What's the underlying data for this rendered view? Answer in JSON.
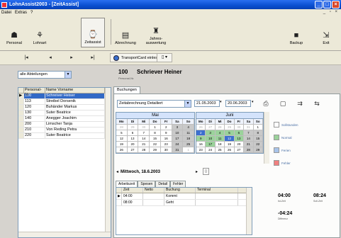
{
  "window": {
    "title": "LohnAssist2003 - [ZeitAssist]"
  },
  "menu": [
    "Datei",
    "Extras",
    "?"
  ],
  "toolbar": {
    "personal": "Personal",
    "lohnart": "Lohnart",
    "zeitassist": "Zeitassist",
    "abrechnung": "Abrechnung",
    "jahres": "Jahres-",
    "auswertung": "auswertung",
    "backup": "Backup",
    "exit": "Exit"
  },
  "nav": {
    "first": "|◂",
    "prev": "◂",
    "next": "▸",
    "last": "▸|",
    "transportcard": "TransportCard einlesen",
    "dropdown_icon": "page-icon"
  },
  "filter": {
    "selected": "alle Abteilungen"
  },
  "employees": {
    "headers": [
      "Personal-Nr",
      "Name Vorname"
    ],
    "rows": [
      {
        "nr": "100",
        "name": "Schreiver Heiser"
      },
      {
        "nr": "113",
        "name": "Streibel Dorsenik"
      },
      {
        "nr": "120",
        "name": "Buhänder Markus"
      },
      {
        "nr": "130",
        "name": "Suter Beatrice"
      },
      {
        "nr": "140",
        "name": "Anegger Joachim"
      },
      {
        "nr": "200",
        "name": "Limscher Tanja"
      },
      {
        "nr": "210",
        "name": "Von Reding Petra"
      },
      {
        "nr": "220",
        "name": "Suter Beatrice"
      }
    ]
  },
  "person": {
    "nr": "100",
    "nr_label": "Personal-Nr.",
    "name": "Schriever Heiner"
  },
  "tabs": {
    "buchungen": "Buchungen"
  },
  "report": {
    "selected": "Zeitabrechnung Detailiert",
    "from": "21.05.2003",
    "to": "20.06.2003"
  },
  "calendar": {
    "weekdays": [
      "Mo",
      "Di",
      "Mi",
      "Do",
      "Fr",
      "Sa",
      "So"
    ],
    "months": [
      {
        "name": "Mai",
        "days": [
          "28",
          "29",
          "30",
          "1",
          "2",
          "3",
          "4",
          "5",
          "6",
          "7",
          "8",
          "9",
          "10",
          "11",
          "12",
          "13",
          "14",
          "15",
          "16",
          "17",
          "18",
          "19",
          "20",
          "21",
          "22",
          "23",
          "24",
          "25",
          "26",
          "27",
          "28",
          "29",
          "30",
          "31",
          "1"
        ]
      },
      {
        "name": "Juni",
        "days": [
          "26",
          "27",
          "28",
          "29",
          "30",
          "31",
          "1",
          "2",
          "3",
          "4",
          "5",
          "6",
          "7",
          "8",
          "9",
          "10",
          "11",
          "12",
          "13",
          "14",
          "15",
          "16",
          "17",
          "18",
          "19",
          "20",
          "21",
          "22",
          "23",
          "24",
          "25",
          "26",
          "27",
          "28",
          "29"
        ]
      }
    ],
    "legend": [
      "Sollstunden",
      "Normal",
      "Ferien",
      "Fehler"
    ]
  },
  "day": {
    "label": "Mittwoch, 18.6.2003"
  },
  "subtabs": [
    "Arbeitszeit",
    "Spesen",
    "Detail",
    "Fehler"
  ],
  "bookings": {
    "headers": [
      "Zeit",
      "Netto",
      "Buchung",
      "Terminal"
    ],
    "rows": [
      {
        "zeit": "04:00",
        "netto": "",
        "buchung": "Kommt",
        "terminal": ""
      },
      {
        "zeit": "08:00",
        "netto": "",
        "buchung": "Geht",
        "terminal": ""
      }
    ]
  },
  "summary": {
    "ist": "04:00",
    "ist_label": "Ist-Zeit",
    "soll": "08:24",
    "soll_label": "Soll-Zeit",
    "diff": "-04:24",
    "diff_label": "Differenz"
  },
  "colors": {
    "titlebar": "#0a4fd0",
    "selection": "#3169c6",
    "calendar_blue": "#3c6fcf",
    "calendar_green": "#9bd29b",
    "ferien": "#a8c4ea",
    "fehler": "#f08080"
  }
}
